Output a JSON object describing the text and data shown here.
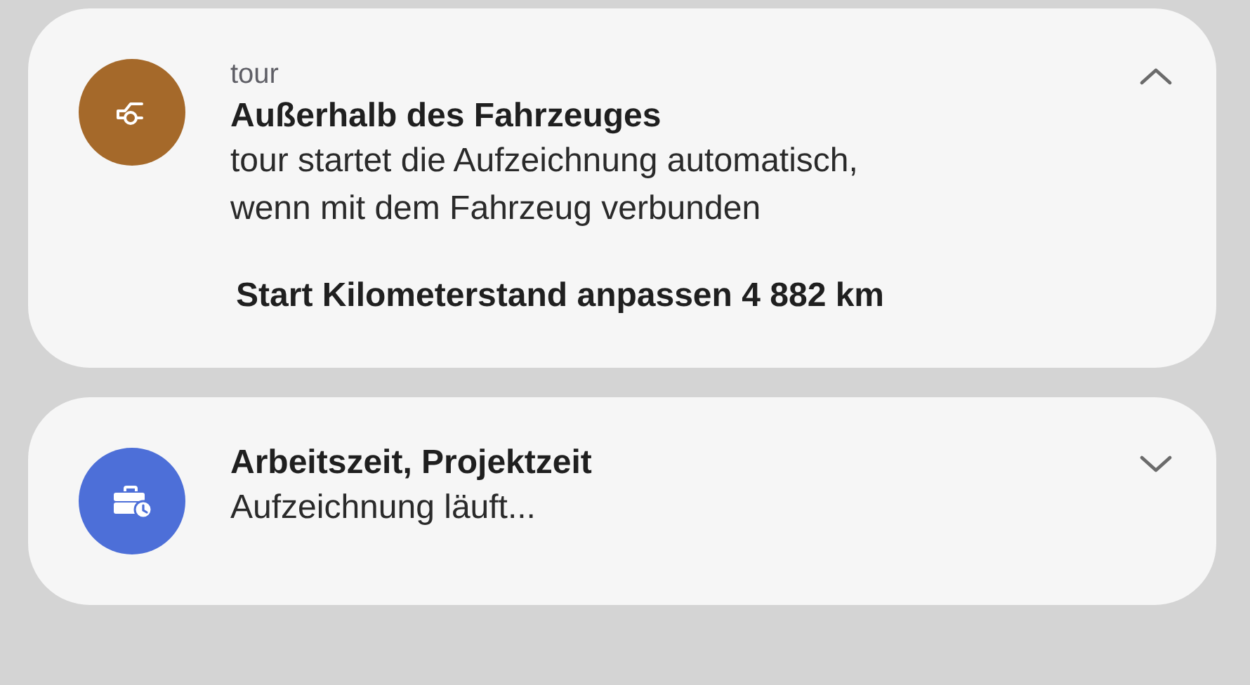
{
  "notifications": [
    {
      "kind": "car",
      "color": "#a5692a",
      "app": "tour",
      "title": "Außerhalb des Fahrzeuges",
      "body": [
        "tour startet die Aufzeichnung automatisch,",
        "wenn mit dem Fahrzeug verbunden"
      ],
      "action": "Start Kilometerstand anpassen 4 882 km",
      "expanded": true
    },
    {
      "kind": "briefcase",
      "color": "#4d6fd8",
      "title": "Arbeitszeit, Projektzeit",
      "body": [
        "Aufzeichnung läuft..."
      ],
      "expanded": false
    }
  ]
}
